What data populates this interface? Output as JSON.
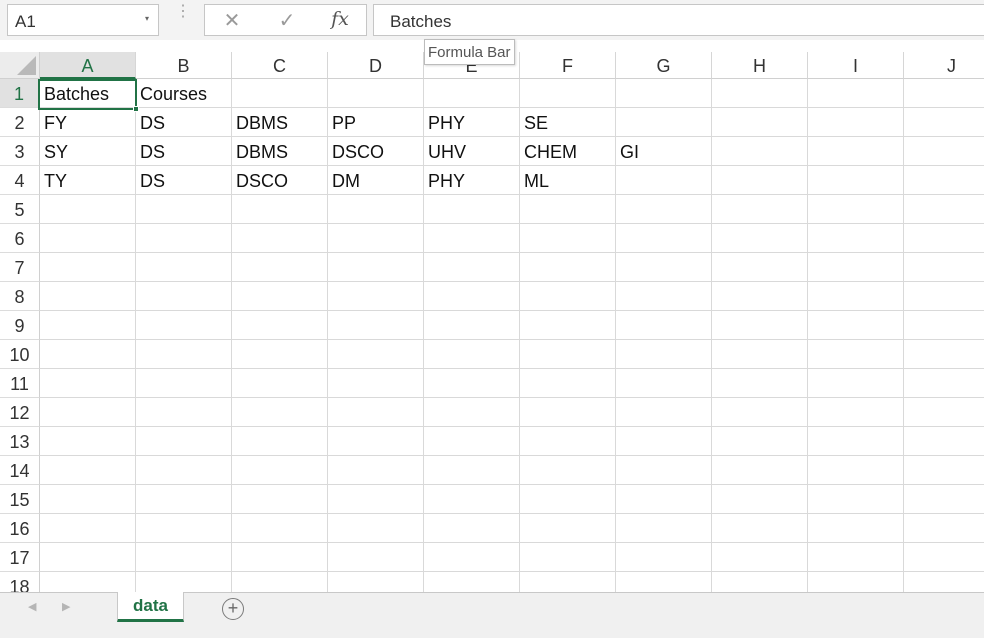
{
  "formula_bar": {
    "name_box": "A1",
    "name_box_arrow": "▾",
    "dots": "⋮",
    "cancel_symbol": "✕",
    "enter_symbol": "✓",
    "fx_symbol": "fx",
    "value": "Batches",
    "tooltip": "Formula Bar"
  },
  "columns": [
    "A",
    "B",
    "C",
    "D",
    "E",
    "F",
    "G",
    "H",
    "I",
    "J"
  ],
  "rows": [
    "1",
    "2",
    "3",
    "4",
    "5",
    "6",
    "7",
    "8",
    "9",
    "10",
    "11",
    "12",
    "13",
    "14",
    "15",
    "16",
    "17",
    "18"
  ],
  "cells": [
    [
      "Batches",
      "Courses",
      "",
      "",
      "",
      "",
      "",
      "",
      "",
      ""
    ],
    [
      "FY",
      "DS",
      "DBMS",
      "PP",
      "PHY",
      "SE",
      "",
      "",
      "",
      ""
    ],
    [
      "SY",
      "DS",
      "DBMS",
      "DSCO",
      "UHV",
      "CHEM",
      "GI",
      "",
      "",
      ""
    ],
    [
      "TY",
      "DS",
      "DSCO",
      "DM",
      "PHY",
      "ML",
      "",
      "",
      "",
      ""
    ]
  ],
  "selected": {
    "column": "A",
    "row": "1"
  },
  "sheet_tabs": {
    "active": "data",
    "prev_symbol": "◀",
    "next_symbol": "▶",
    "add_symbol": "+"
  },
  "colors": {
    "accent": "#217346",
    "grid_line": "#d9d9d9",
    "header_selected": "#e1e1e1"
  }
}
